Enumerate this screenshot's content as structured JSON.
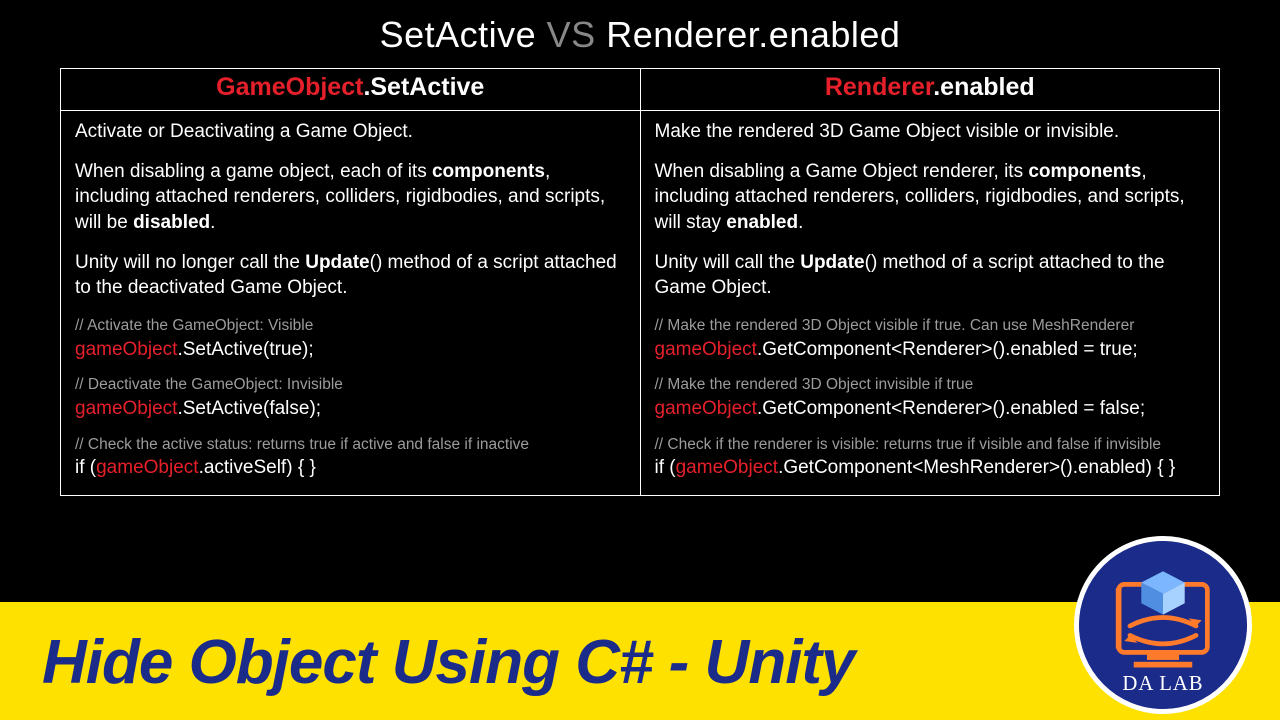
{
  "title": {
    "a": "SetActive",
    "vs": "VS",
    "b": "Renderer.enabled"
  },
  "left": {
    "header_red": "GameObject",
    "header_rest": ".SetActive",
    "p1": "Activate or Deactivating a Game Object.",
    "p2_a": "When disabling a game object, each of its ",
    "p2_b": "components",
    "p2_c": ", including attached renderers, colliders, rigidbodies, and scripts, will be ",
    "p2_d": "disabled",
    "p2_e": ".",
    "p3_a": "Unity will no longer call the ",
    "p3_b": "Update",
    "p3_c": "() method of a script attached to the deactivated Game Object.",
    "c1_comment": "// Activate the GameObject: Visible",
    "c1_obj": "gameObject",
    "c1_rest": ".SetActive(true);",
    "c2_comment": "// Deactivate the GameObject: Invisible",
    "c2_obj": "gameObject",
    "c2_rest": ".SetActive(false);",
    "c3_comment": "// Check the active status: returns true if active and false if inactive",
    "c3_pre": "if (",
    "c3_obj": "gameObject",
    "c3_post": ".activeSelf) { }"
  },
  "right": {
    "header_red": "Renderer",
    "header_rest": ".enabled",
    "p1": "Make the rendered 3D Game Object visible or invisible.",
    "p2_a": "When disabling a Game Object renderer, its ",
    "p2_b": "components",
    "p2_c": ", including attached renderers, colliders, rigidbodies, and scripts, will stay ",
    "p2_d": "enabled",
    "p2_e": ".",
    "p3_a": "Unity will call the ",
    "p3_b": "Update",
    "p3_c": "() method of a script attached to the Game Object.",
    "c1_comment": "// Make the rendered 3D Object visible if true. Can use MeshRenderer",
    "c1_obj": "gameObject",
    "c1_rest": ".GetComponent<Renderer>().enabled = true;",
    "c2_comment": "// Make the rendered 3D Object invisible if true",
    "c2_obj": "gameObject",
    "c2_rest": ".GetComponent<Renderer>().enabled = false;",
    "c3_comment": "// Check if the renderer is visible: returns true if visible and false if invisible",
    "c3_pre": "if (",
    "c3_obj": "gameObject",
    "c3_post": ".GetComponent<MeshRenderer>().enabled) { }"
  },
  "banner": "Hide Object Using C# - Unity",
  "logo_text": "DA LAB"
}
